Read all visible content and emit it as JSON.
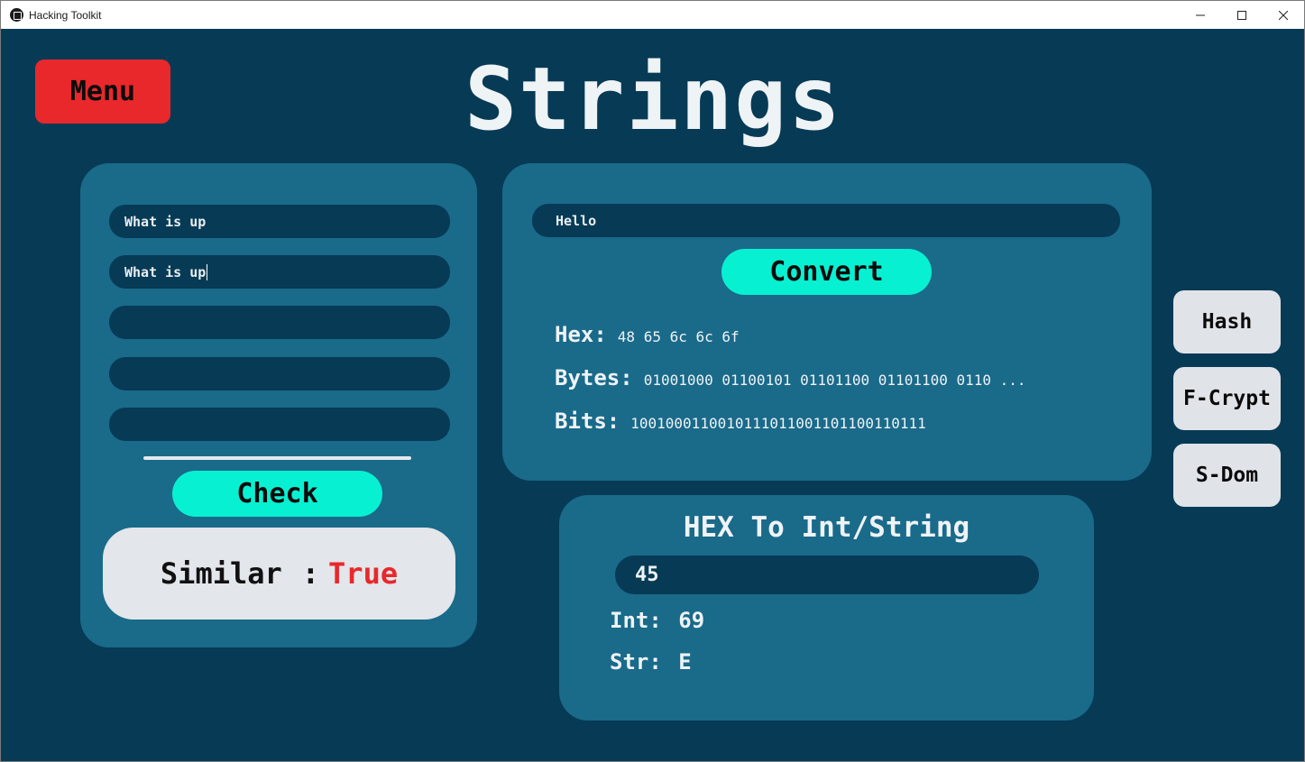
{
  "window": {
    "title": "Hacking Toolkit"
  },
  "menu_button": {
    "label": "Menu"
  },
  "page_title": "Strings",
  "compare_panel": {
    "inputs": [
      "What is up",
      "What is up",
      "",
      "",
      ""
    ],
    "check_label": "Check",
    "result": {
      "label": "Similar",
      "separator": ":",
      "value": "True"
    }
  },
  "convert_panel": {
    "input_value": "Hello",
    "convert_label": "Convert",
    "hex": {
      "label": "Hex:",
      "value": "48 65 6c 6c 6f"
    },
    "bytes": {
      "label": "Bytes:",
      "value": "01001000 01100101 01101100 01101100 0110 ..."
    },
    "bits": {
      "label": "Bits:",
      "value": "1001000110010111011001101100110111"
    }
  },
  "hex_panel": {
    "title": "HEX To Int/String",
    "input_value": "45",
    "int": {
      "label": "Int:",
      "value": "69"
    },
    "str": {
      "label": "Str:",
      "value": "E"
    }
  },
  "side_nav": [
    "Hash",
    "F-Crypt",
    "S-Dom"
  ],
  "colors": {
    "background": "#073a55",
    "panel": "#1a6a8a",
    "accent_cyan": "#08f0d2",
    "menu_red": "#e8282b",
    "true_red": "#e8282b",
    "light_button": "#e0e4e9"
  }
}
